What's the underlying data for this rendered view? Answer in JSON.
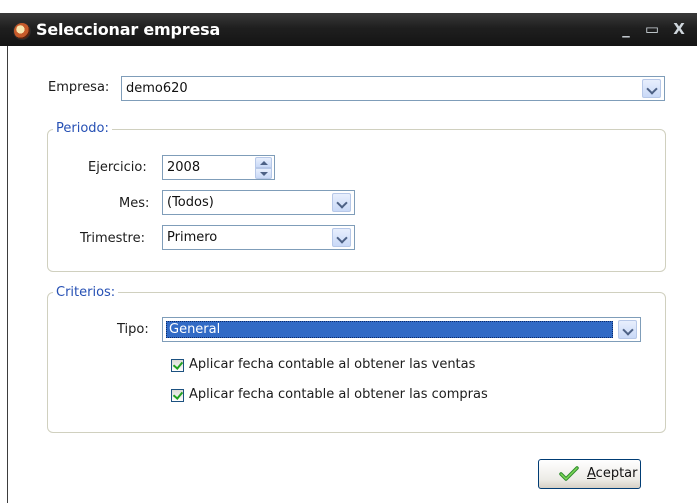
{
  "window": {
    "title": "Seleccionar empresa",
    "controls": {
      "minimize": "_",
      "maximize": "▭",
      "close": "X"
    }
  },
  "empresa": {
    "label": "Empresa:",
    "value": "demo620"
  },
  "periodo": {
    "title": "Periodo:",
    "ejercicio": {
      "label": "Ejercicio:",
      "value": "2008"
    },
    "mes": {
      "label": "Mes:",
      "value": "(Todos)"
    },
    "trimestre": {
      "label": "Trimestre:",
      "value": "Primero"
    }
  },
  "criterios": {
    "title": "Criterios:",
    "tipo": {
      "label": "Tipo:",
      "value": "General"
    },
    "check_ventas": {
      "label": "Aplicar fecha contable al obtener las ventas",
      "checked": true
    },
    "check_compras": {
      "label": "Aplicar fecha contable al obtener las compras",
      "checked": true
    }
  },
  "actions": {
    "ok_label": "Aceptar"
  },
  "colors": {
    "titlebar": "#1f1f1f",
    "group_title": "#2650b4",
    "selection": "#316ac5",
    "field_border": "#7f9db9"
  }
}
